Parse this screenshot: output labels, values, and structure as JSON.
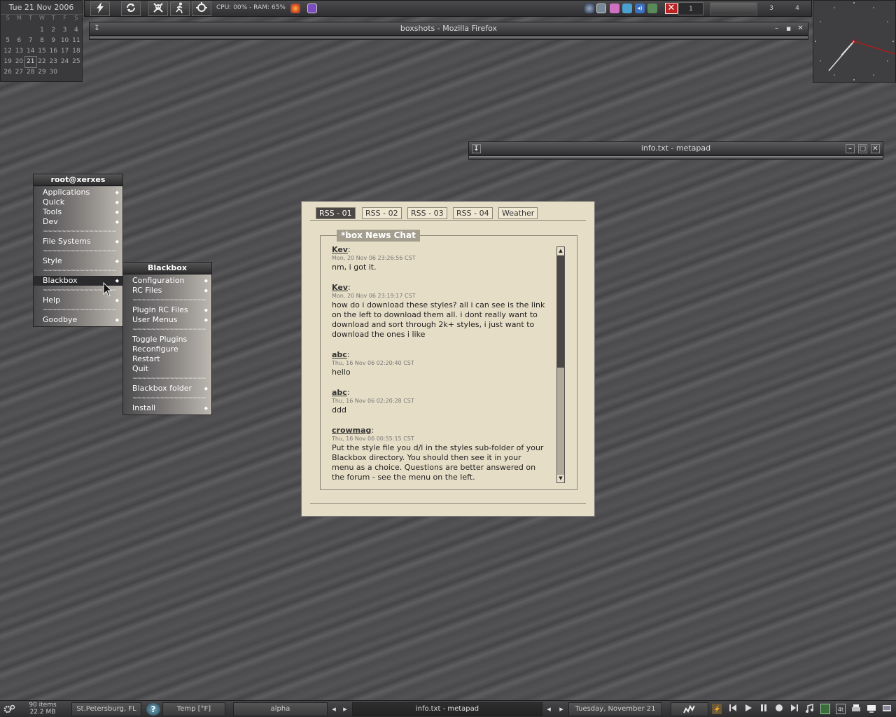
{
  "calendar": {
    "title": "Tue 21 Nov 2006",
    "weekday_headers": [
      "S",
      "M",
      "T",
      "W",
      "T",
      "F",
      "S"
    ],
    "rows": [
      [
        "",
        "",
        "",
        "1",
        "2",
        "3",
        "4"
      ],
      [
        "5",
        "6",
        "7",
        "8",
        "9",
        "10",
        "11"
      ],
      [
        "12",
        "13",
        "14",
        "15",
        "16",
        "17",
        "18"
      ],
      [
        "19",
        "20",
        "21",
        "22",
        "23",
        "24",
        "25"
      ],
      [
        "26",
        "27",
        "28",
        "29",
        "30",
        "",
        ""
      ]
    ],
    "today": "21"
  },
  "toolbar": {
    "cpu_ram": "CPU: 00% - RAM: 65%",
    "close_all_glyph": "✕",
    "workspaces": [
      "1",
      "",
      "3",
      "4"
    ],
    "icons": [
      "lightning-icon",
      "refresh-icon",
      "skull-icon",
      "runner-icon",
      "spinner-icon"
    ]
  },
  "firefox_window": {
    "title": "boxshots - Mozilla Firefox",
    "btn_min": "–",
    "btn_max": "■",
    "btn_close": "✕",
    "btn_shade": "↧"
  },
  "metapad_window": {
    "title": "info.txt - metapad",
    "btn_min": "–",
    "btn_max": "□",
    "btn_close": "✕",
    "btn_shade": "↧"
  },
  "root_menu": {
    "title": "root@xerxes",
    "items": [
      {
        "label": "Applications",
        "submenu": true
      },
      {
        "label": "Quick",
        "submenu": true
      },
      {
        "label": "Tools",
        "submenu": true
      },
      {
        "label": "Dev",
        "submenu": true
      },
      {
        "label": "~~~~~~~~~~~~~~~~",
        "sep": true
      },
      {
        "label": "File Systems",
        "submenu": true
      },
      {
        "label": "~~~~~~~~~~~~~~~~",
        "sep": true
      },
      {
        "label": "Style",
        "submenu": true
      },
      {
        "label": "~~~~~~~~~~~~~~~~",
        "sep": true
      },
      {
        "label": "Blackbox",
        "submenu": true,
        "active": true
      },
      {
        "label": "~~~~~~~~~~~~~~~~",
        "sep": true
      },
      {
        "label": "Help",
        "submenu": true
      },
      {
        "label": "~~~~~~~~~~~~~~~~",
        "sep": true
      },
      {
        "label": "Goodbye",
        "submenu": true
      }
    ]
  },
  "blackbox_menu": {
    "title": "Blackbox",
    "items": [
      {
        "label": "Configuration",
        "submenu": true
      },
      {
        "label": "RC Files",
        "submenu": true
      },
      {
        "label": "~~~~~~~~~~~~~~~~",
        "sep": true
      },
      {
        "label": "Plugin RC Files",
        "submenu": true
      },
      {
        "label": "User Menus",
        "submenu": true
      },
      {
        "label": "~~~~~~~~~~~~~~~~",
        "sep": true
      },
      {
        "label": "Toggle Plugins"
      },
      {
        "label": "Reconfigure"
      },
      {
        "label": "Restart"
      },
      {
        "label": "Quit"
      },
      {
        "label": "~~~~~~~~~~~~~~~~",
        "sep": true
      },
      {
        "label": "Blackbox folder",
        "submenu": true
      },
      {
        "label": "~~~~~~~~~~~~~~~~",
        "sep": true
      },
      {
        "label": "Install",
        "submenu": true
      }
    ]
  },
  "rss": {
    "tabs": [
      "RSS - 01",
      "RSS - 02",
      "RSS - 03",
      "RSS - 04",
      "Weather"
    ],
    "active_tab": 0,
    "feed_title": "*box News Chat",
    "posts": [
      {
        "author": "Kev",
        "date": "Mon, 20 Nov 06 23:26:56 CST",
        "lines": [
          "nm, i got it."
        ]
      },
      {
        "author": "Kev",
        "date": "Mon, 20 Nov 06 23:19:17 CST",
        "lines": [
          "how do i download these styles? all i can see is the link",
          "on the left to download them all. i dont really want to",
          "download and sort through 2k+ styles, i just want to",
          "download the ones i like"
        ]
      },
      {
        "author": "abc",
        "date": "Thu, 16 Nov 06 02:20:40 CST",
        "lines": [
          "hello"
        ]
      },
      {
        "author": "abc",
        "date": "Thu, 16 Nov 06 02:20:28 CST",
        "lines": [
          "ddd"
        ]
      },
      {
        "author": "crowmag",
        "date": "Thu, 16 Nov 06 00:55:15 CST",
        "lines": [
          "Put the style file you d/l in the styles sub-folder of your",
          "Blackbox directory. You should then see it in your",
          "menu as a choice. Questions are better answered on",
          "the forum - see the menu on the left."
        ]
      }
    ],
    "scroll_up": "▲",
    "scroll_down": "▼"
  },
  "bottombar": {
    "items_count": "90 items",
    "items_size": "22.2 MB",
    "location": "St.Petersburg, FL",
    "temp": "Temp [°F]",
    "workspace": "alpha",
    "task": "info.txt - metapad",
    "date": "Tuesday, November 21",
    "prev": "◂",
    "next": "▸"
  },
  "colors": {
    "accent": "#e6ddc6",
    "close_red": "#b22222"
  }
}
